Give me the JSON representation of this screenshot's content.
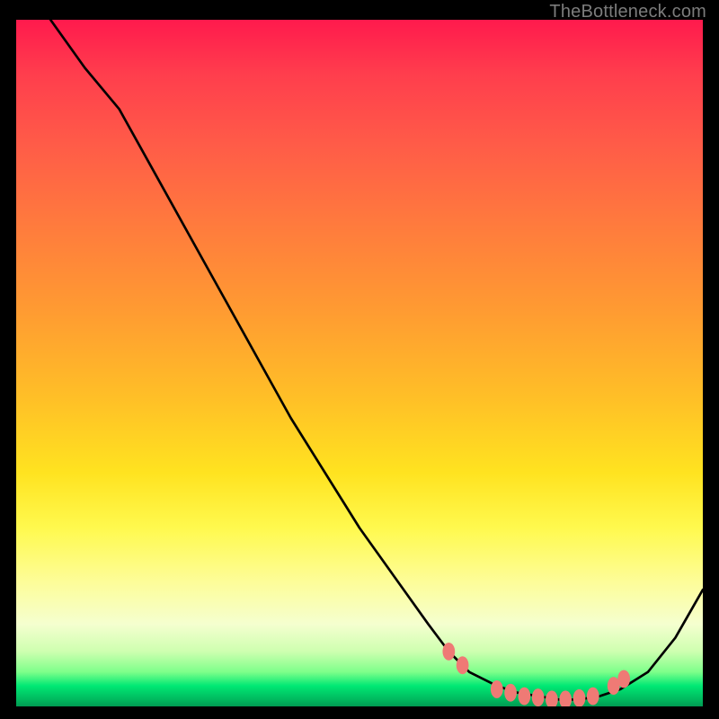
{
  "attribution": "TheBottleneck.com",
  "chart_data": {
    "type": "line",
    "title": "",
    "xlabel": "",
    "ylabel": "",
    "xlim": [
      0,
      100
    ],
    "ylim": [
      0,
      100
    ],
    "series": [
      {
        "name": "bottleneck-curve",
        "x": [
          5,
          10,
          15,
          20,
          25,
          30,
          35,
          40,
          45,
          50,
          55,
          60,
          63,
          66,
          70,
          73,
          76,
          79,
          82,
          85,
          88,
          92,
          96,
          100
        ],
        "y": [
          100,
          93,
          87,
          78,
          69,
          60,
          51,
          42,
          34,
          26,
          19,
          12,
          8,
          5,
          3,
          2,
          1.5,
          1,
          1,
          1.5,
          2.5,
          5,
          10,
          17
        ]
      }
    ],
    "markers": {
      "name": "highlight-dots",
      "color": "#ef7a75",
      "points": [
        {
          "x": 63,
          "y": 8
        },
        {
          "x": 65,
          "y": 6
        },
        {
          "x": 70,
          "y": 2.5
        },
        {
          "x": 72,
          "y": 2
        },
        {
          "x": 74,
          "y": 1.5
        },
        {
          "x": 76,
          "y": 1.3
        },
        {
          "x": 78,
          "y": 1
        },
        {
          "x": 80,
          "y": 1
        },
        {
          "x": 82,
          "y": 1.2
        },
        {
          "x": 84,
          "y": 1.5
        },
        {
          "x": 87,
          "y": 3
        },
        {
          "x": 88.5,
          "y": 4
        }
      ]
    },
    "gradient_stops": [
      {
        "pos": 0,
        "color": "#ff1a4d"
      },
      {
        "pos": 50,
        "color": "#ffbf27"
      },
      {
        "pos": 78,
        "color": "#fdfd6a"
      },
      {
        "pos": 97,
        "color": "#00e874"
      },
      {
        "pos": 100,
        "color": "#009a52"
      }
    ]
  }
}
